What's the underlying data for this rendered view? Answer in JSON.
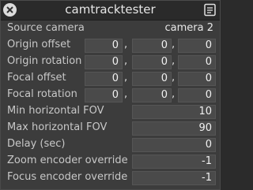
{
  "window": {
    "title": "camtracktester",
    "close_icon": "close-icon",
    "save_icon": "save-icon"
  },
  "rows": {
    "source_camera": {
      "label": "Source camera",
      "value": "camera 2"
    },
    "origin_offset": {
      "label": "Origin offset",
      "values": [
        "0",
        "0",
        "0"
      ]
    },
    "origin_rotation": {
      "label": "Origin rotation",
      "values": [
        "0",
        "0",
        "0"
      ]
    },
    "focal_offset": {
      "label": "Focal offset",
      "values": [
        "0",
        "0",
        "0"
      ]
    },
    "focal_rotation": {
      "label": "Focal rotation",
      "values": [
        "0",
        "0",
        "0"
      ]
    },
    "min_hfov": {
      "label": "Min horizontal FOV",
      "value": "10"
    },
    "max_hfov": {
      "label": "Max horizontal FOV",
      "value": "90"
    },
    "delay": {
      "label": "Delay (sec)",
      "value": "0"
    },
    "zoom_override": {
      "label": "Zoom encoder override",
      "value": "-1"
    },
    "focus_override": {
      "label": "Focus encoder override",
      "value": "-1"
    }
  },
  "separator": ","
}
